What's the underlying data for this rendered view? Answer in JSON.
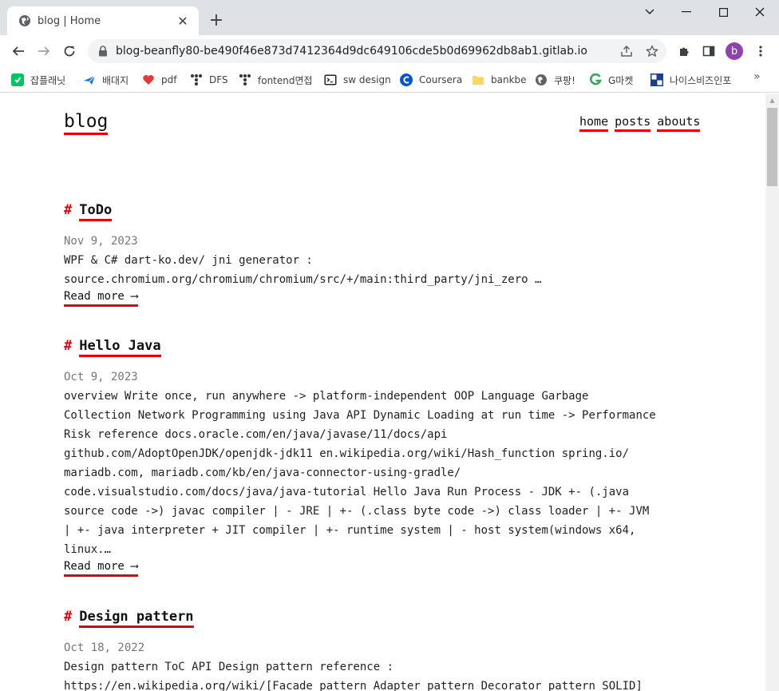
{
  "browser": {
    "tab_title": "blog | Home",
    "tab_close": "✕",
    "new_tab": "+",
    "url": "blog-beanfly80-be490f46e873d7412364d9dc649106cde5b0d69962db8ab1.gitlab.io",
    "profile_initial": "b",
    "accent_color": "#8e44ad"
  },
  "bookmarks": [
    {
      "label": "잡플래닛",
      "icon": "jobplanet-icon"
    },
    {
      "label": "배대지",
      "icon": "plane-icon"
    },
    {
      "label": "pdf",
      "icon": "heart-icon"
    },
    {
      "label": "DFS",
      "icon": "tree-icon"
    },
    {
      "label": "fontend면접",
      "icon": "tree-icon"
    },
    {
      "label": "sw design",
      "icon": "terminal-icon"
    },
    {
      "label": "Coursera",
      "icon": "coursera-icon"
    },
    {
      "label": "bankbe",
      "icon": "folder-icon"
    },
    {
      "label": "쿠팡!",
      "icon": "globe-icon"
    },
    {
      "label": "G마켓",
      "icon": "g-icon"
    },
    {
      "label": "나이스비즈인포",
      "icon": "nice-icon"
    }
  ],
  "bookmarks_more": "»",
  "site": {
    "logo": "blog",
    "nav": [
      "home",
      "posts",
      "abouts"
    ],
    "accent_color": "#e4000f"
  },
  "posts": [
    {
      "hash": "#",
      "title": "ToDo",
      "date": "Nov 9, 2023",
      "summary": "WPF & C# dart-ko.dev/ jni generator :\nsource.chromium.org/chromium/chromium/src/+/main:third_party/jni_zero …",
      "read_more": "Read more ⟶"
    },
    {
      "hash": "#",
      "title": "Hello Java",
      "date": "Oct 9, 2023",
      "summary": "overview Write once, run anywhere -> platform-independent OOP Language Garbage\nCollection Network Programming using Java API Dynamic Loading at run time -> Performance\nRisk reference docs.oracle.com/en/java/javase/11/docs/api\ngithub.com/AdoptOpenJDK/openjdk-jdk11 en.wikipedia.org/wiki/Hash_function spring.io/\nmariadb.com, mariadb.com/kb/en/java-connector-using-gradle/\ncode.visualstudio.com/docs/java/java-tutorial Hello Java Run Process - JDK +- (.java\nsource code ->) javac compiler | - JRE | +- (.class byte code ->) class loader | +- JVM\n| +- java interpreter + JIT compiler | +- runtime system | - host system(windows x64,\nlinux.…",
      "read_more": "Read more ⟶"
    },
    {
      "hash": "#",
      "title": "Design pattern",
      "date": "Oct 18, 2022",
      "summary": "Design pattern ToC API Design pattern reference :\nhttps://en.wikipedia.org/wiki/[Facade pattern Adapter pattern Decorator pattern SOLID]",
      "read_more": "Read more ⟶"
    }
  ]
}
